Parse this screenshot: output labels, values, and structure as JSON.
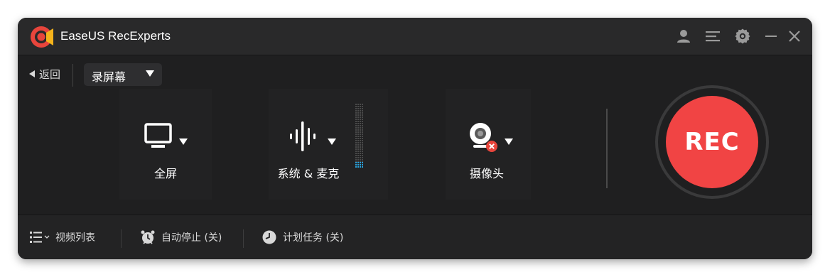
{
  "window": {
    "title": "EaseUS RecExperts"
  },
  "titlebar": {
    "icons": [
      "account-icon",
      "menu-icon",
      "settings-icon",
      "minimize-icon",
      "close-icon"
    ]
  },
  "nav": {
    "back_label": "返回",
    "mode_selected": "录屏幕"
  },
  "sources": {
    "screen": {
      "label": "全屏",
      "icon": "monitor-icon"
    },
    "audio": {
      "label": "系统 & 麦克",
      "icon": "audio-wave-icon"
    },
    "webcam": {
      "label": "摄像头",
      "icon": "webcam-icon",
      "status": "disabled"
    }
  },
  "rec_button": {
    "label": "REC",
    "color": "#f14444"
  },
  "bottom": {
    "video_list": "视频列表",
    "auto_stop": "自动停止 (关)",
    "schedule": "计划任务 (关)"
  },
  "colors": {
    "window_bg": "#1f1f20",
    "titlebar_bg": "#29292a",
    "accent_red": "#f14444"
  }
}
